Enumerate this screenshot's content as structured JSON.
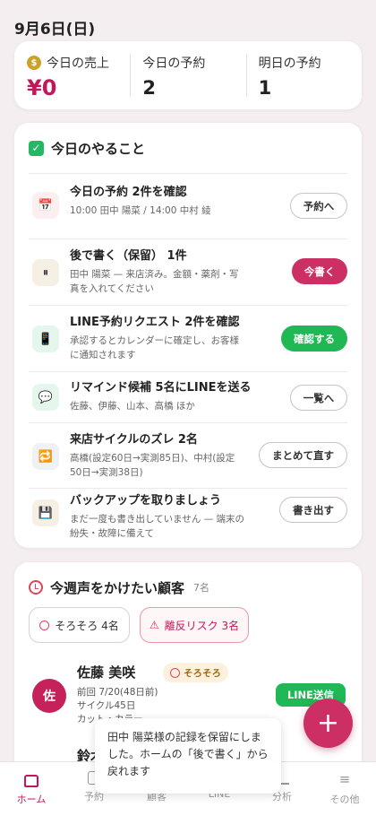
{
  "header": {
    "date": "9月6日(日)"
  },
  "stats": [
    {
      "label": "今日の売上",
      "value": "¥0",
      "icon": "money-bag-icon"
    },
    {
      "label": "今日の予約",
      "value": "2"
    },
    {
      "label": "明日の予約",
      "value": "1"
    }
  ],
  "todo": {
    "title": "今日のやること",
    "items": [
      {
        "icon": "calendar-icon",
        "glyph": "📅",
        "title": "今日の予約 2件を確認",
        "subtitle": "10:00 田中 陽菜 / 14:00 中村 綾",
        "button": "予約へ"
      },
      {
        "icon": "pause-icon",
        "glyph": "⏸",
        "title": "後で書く（保留） 1件",
        "subtitle": "田中 陽菜 — 来店済み。金額・薬剤・写真を入れてください",
        "button": "今書く"
      },
      {
        "icon": "mobile-icon",
        "glyph": "📱",
        "title": "LINE予約リクエスト 2件を確認",
        "subtitle": "承認するとカレンダーに確定し、お客様に通知されます",
        "button": "確認する"
      },
      {
        "icon": "speech-bubble-icon",
        "glyph": "💬",
        "title": "リマインド候補 5名にLINEを送る",
        "subtitle": "佐藤、伊藤、山本、高橋 ほか",
        "button": "一覧へ"
      },
      {
        "icon": "repeat-icon",
        "glyph": "🔁",
        "title": "来店サイクルのズレ 2名",
        "subtitle": "高橋(設定60日→実測85日)、中村(設定50日→実測38日)",
        "button": "まとめて直す"
      },
      {
        "icon": "floppy-disk-icon",
        "glyph": "💾",
        "title": "バックアップを取りましょう",
        "subtitle": "まだ一度も書き出していません — 端末の紛失・故障に備えて",
        "button": "書き出す"
      }
    ]
  },
  "customers": {
    "title": "今週声をかけたい顧客",
    "count": "7名",
    "filters": [
      {
        "label": "そろそろ 4名"
      },
      {
        "label": "離反リスク 3名"
      }
    ],
    "list": [
      {
        "initial": "佐",
        "name": "佐藤 美咲",
        "badge": "そろそろ",
        "last_visit": "前回 7/20(48日前)",
        "cycle": "サイクル45日",
        "menu": "カット・カラー",
        "action": "LINE送信"
      },
      {
        "name": "鈴木"
      }
    ]
  },
  "toast": {
    "message": "田中 陽菜様の記録を保留にしました。ホームの「後で書く」から戻れます"
  },
  "bottom_nav": [
    {
      "label": "ホーム",
      "icon": "home-icon",
      "active": true
    },
    {
      "label": "予約",
      "icon": "calendar-icon"
    },
    {
      "label": "顧客",
      "icon": "users-icon"
    },
    {
      "label": "LINE",
      "icon": "chat-icon"
    },
    {
      "label": "分析",
      "icon": "bar-chart-icon"
    },
    {
      "label": "その他",
      "icon": "menu-icon"
    }
  ],
  "fab": {
    "label": "+"
  },
  "colors": {
    "accent": "#c2185b",
    "line_green": "#1fb855",
    "background": "#f4eef0"
  }
}
